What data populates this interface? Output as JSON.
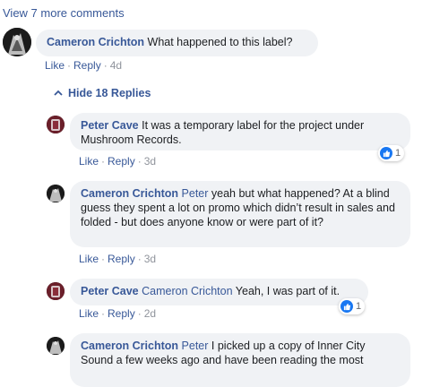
{
  "view_more": "View 7 more comments",
  "actions": {
    "like": "Like",
    "reply": "Reply"
  },
  "hide_replies": "Hide 18 Replies",
  "comment": {
    "author": "Cameron Crichton",
    "text": "What happened to this label?",
    "time": "4d"
  },
  "replies": [
    {
      "author": "Peter Cave",
      "mention": "",
      "text": "It was a temporary label for the project under Mushroom Records.",
      "time": "3d",
      "reactions": "1"
    },
    {
      "author": "Cameron Crichton",
      "mention": "Peter",
      "text": "yeah but what happened? At a blind guess they spent a lot on promo which didn’t result in sales and folded - but does anyone know or were part of it?",
      "time": "3d"
    },
    {
      "author": "Peter Cave",
      "mention": "Cameron Crichton",
      "text": "Yeah, I was part of it.",
      "time": "2d",
      "reactions": "1"
    },
    {
      "author": "Cameron Crichton",
      "mention": "Peter",
      "text": "I picked up a copy of Inner City Sound a few weeks ago and have been reading the most"
    }
  ],
  "colors": {
    "link": "#385898",
    "bubble": "#f0f2f5",
    "like": "#1877f2"
  }
}
